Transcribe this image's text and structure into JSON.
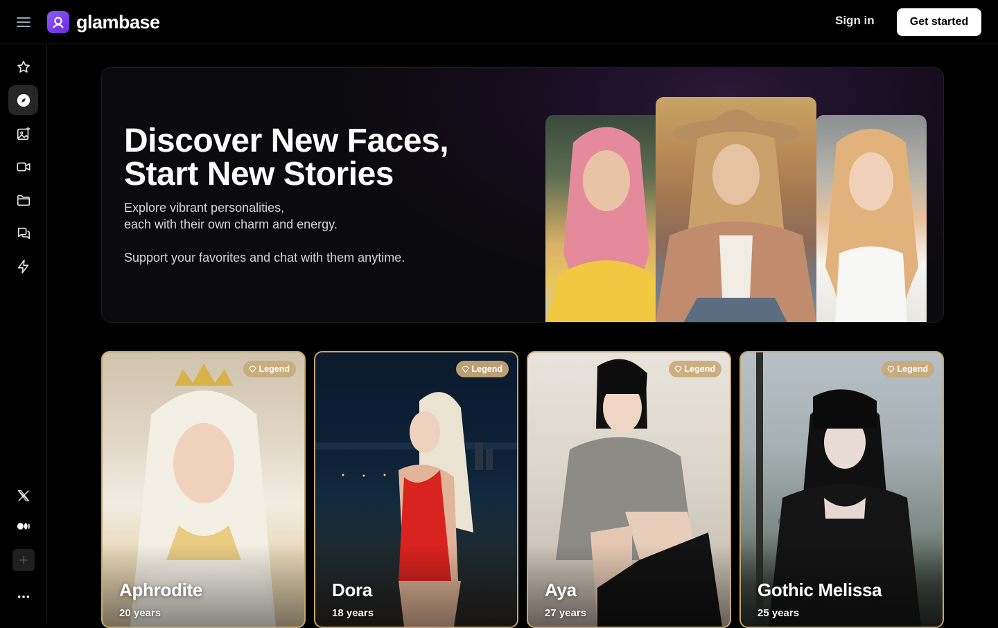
{
  "header": {
    "brand": "glambase",
    "sign_in": "Sign in",
    "get_started": "Get started"
  },
  "sidebar": {
    "items": [
      {
        "icon": "star-icon"
      },
      {
        "icon": "compass-icon",
        "active": true
      },
      {
        "icon": "image-sparkle-icon"
      },
      {
        "icon": "video-icon"
      },
      {
        "icon": "folder-icon"
      },
      {
        "icon": "chat-icon"
      },
      {
        "icon": "lightning-icon"
      }
    ],
    "bottom": [
      {
        "icon": "x-logo-icon"
      },
      {
        "icon": "medium-logo-icon"
      },
      {
        "icon": "plus-icon"
      },
      {
        "icon": "more-icon"
      }
    ]
  },
  "hero": {
    "title_line1": "Discover New Faces,",
    "title_line2": "Start New Stories",
    "subtitle_line1": "Explore vibrant personalities,",
    "subtitle_line2": "each with their own charm and energy.",
    "subtitle_line3": "Support your favorites and chat with them anytime."
  },
  "cards": [
    {
      "name": "Aphrodite",
      "age": "20 years",
      "badge": "Legend"
    },
    {
      "name": "Dora",
      "age": "18 years",
      "badge": "Legend"
    },
    {
      "name": "Aya",
      "age": "27 years",
      "badge": "Legend"
    },
    {
      "name": "Gothic Melissa",
      "age": "25 years",
      "badge": "Legend"
    }
  ],
  "colors": {
    "background": "#000000",
    "accent": "#7c3aed",
    "card_border": "#c5a66c",
    "badge": "#c9aa78"
  }
}
